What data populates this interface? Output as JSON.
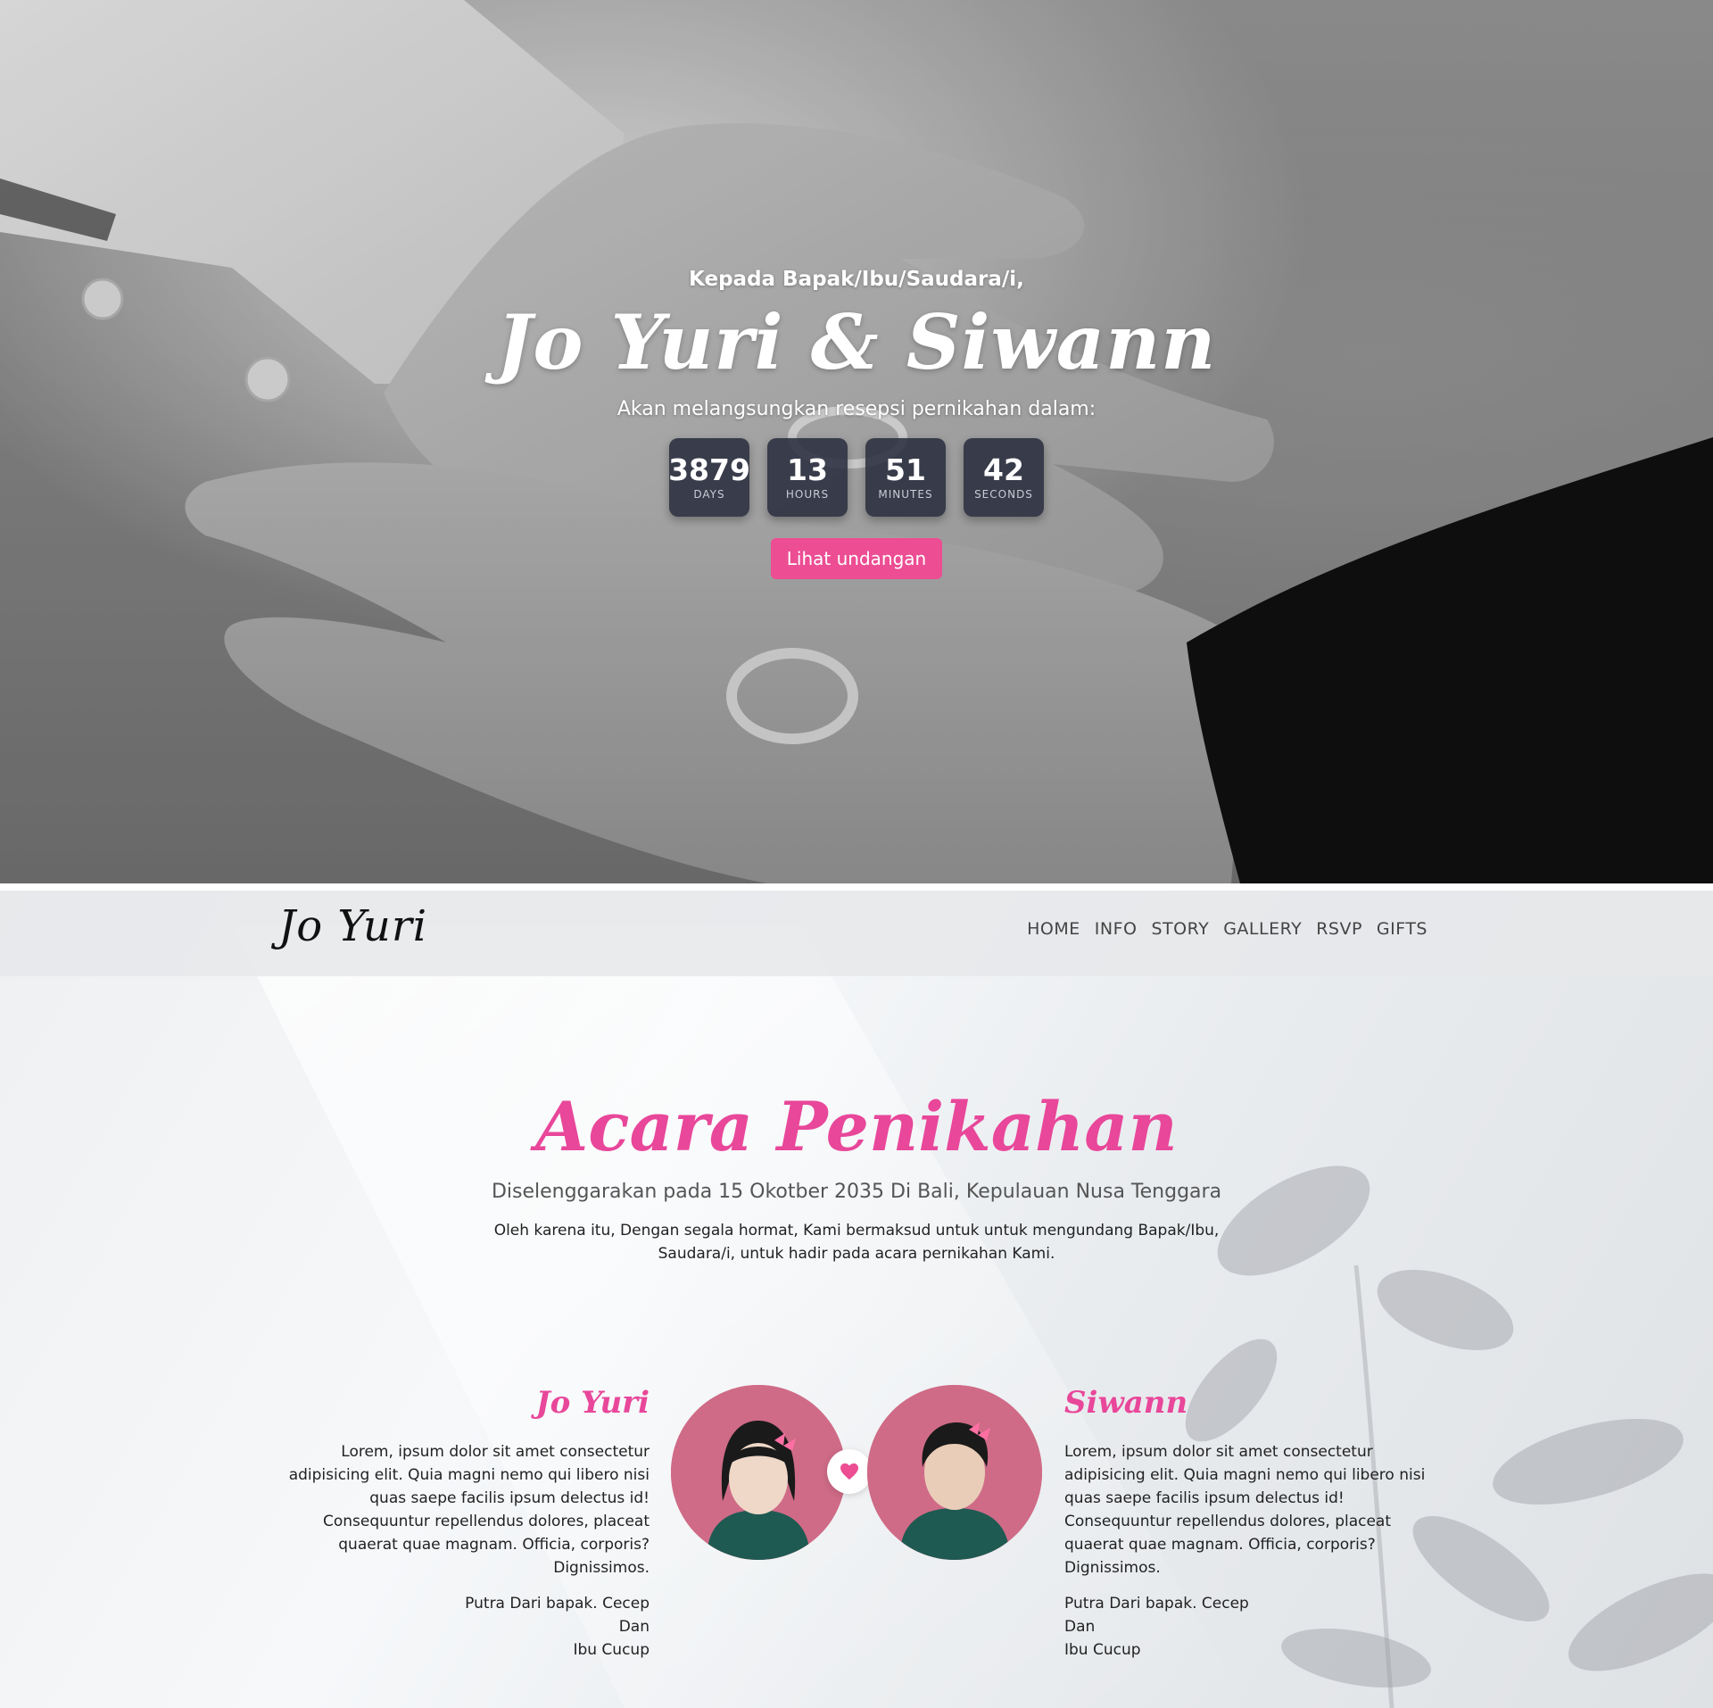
{
  "hero": {
    "greeting": "Kepada Bapak/Ibu/Saudara/i,",
    "names": "Jo Yuri & Siwann",
    "subtitle": "Akan melangsungkan resepsi pernikahan dalam:",
    "countdown": [
      {
        "value": "3879",
        "label": "DAYS"
      },
      {
        "value": "13",
        "label": "HOURS"
      },
      {
        "value": "51",
        "label": "MINUTES"
      },
      {
        "value": "42",
        "label": "SECONDS"
      }
    ],
    "button_label": "Lihat undangan"
  },
  "navbar": {
    "logo": "Jo Yuri",
    "items": [
      "HOME",
      "INFO",
      "STORY",
      "GALLERY",
      "RSVP",
      "GIFTS"
    ]
  },
  "events": {
    "title": "Acara Penikahan",
    "date_line": "Diselenggarakan pada 15 Okotber 2035 Di Bali, Kepulauan Nusa Tenggara",
    "description": "Oleh karena itu, Dengan segala hormat, Kami bermaksud untuk untuk mengundang Bapak/Ibu, Saudara/i, untuk hadir pada acara pernikahan Kami."
  },
  "couple": {
    "bride": {
      "name": "Jo Yuri",
      "bio": "Lorem, ipsum dolor sit amet consectetur adipisicing elit. Quia magni nemo qui libero nisi quas saepe facilis ipsum delectus id! Consequuntur repellendus dolores, placeat quaerat quae magnam. Officia, corporis? Dignissimos.",
      "parents": [
        "Putra Dari bapak. Cecep",
        "Dan",
        "Ibu Cucup"
      ]
    },
    "groom": {
      "name": "Siwann",
      "bio": "Lorem, ipsum dolor sit amet consectetur adipisicing elit. Quia magni nemo qui libero nisi quas saepe facilis ipsum delectus id! Consequuntur repellendus dolores, placeat quaerat quae magnam. Officia, corporis? Dignissimos.",
      "parents": [
        "Putra Dari bapak. Cecep",
        "Dan",
        "Ibu Cucup"
      ]
    }
  },
  "colors": {
    "accent": "#ec4d93",
    "title_pink": "#e8479a",
    "countdown_bg": "#2a2e3e"
  },
  "icons": {
    "heart": "heart-icon"
  }
}
